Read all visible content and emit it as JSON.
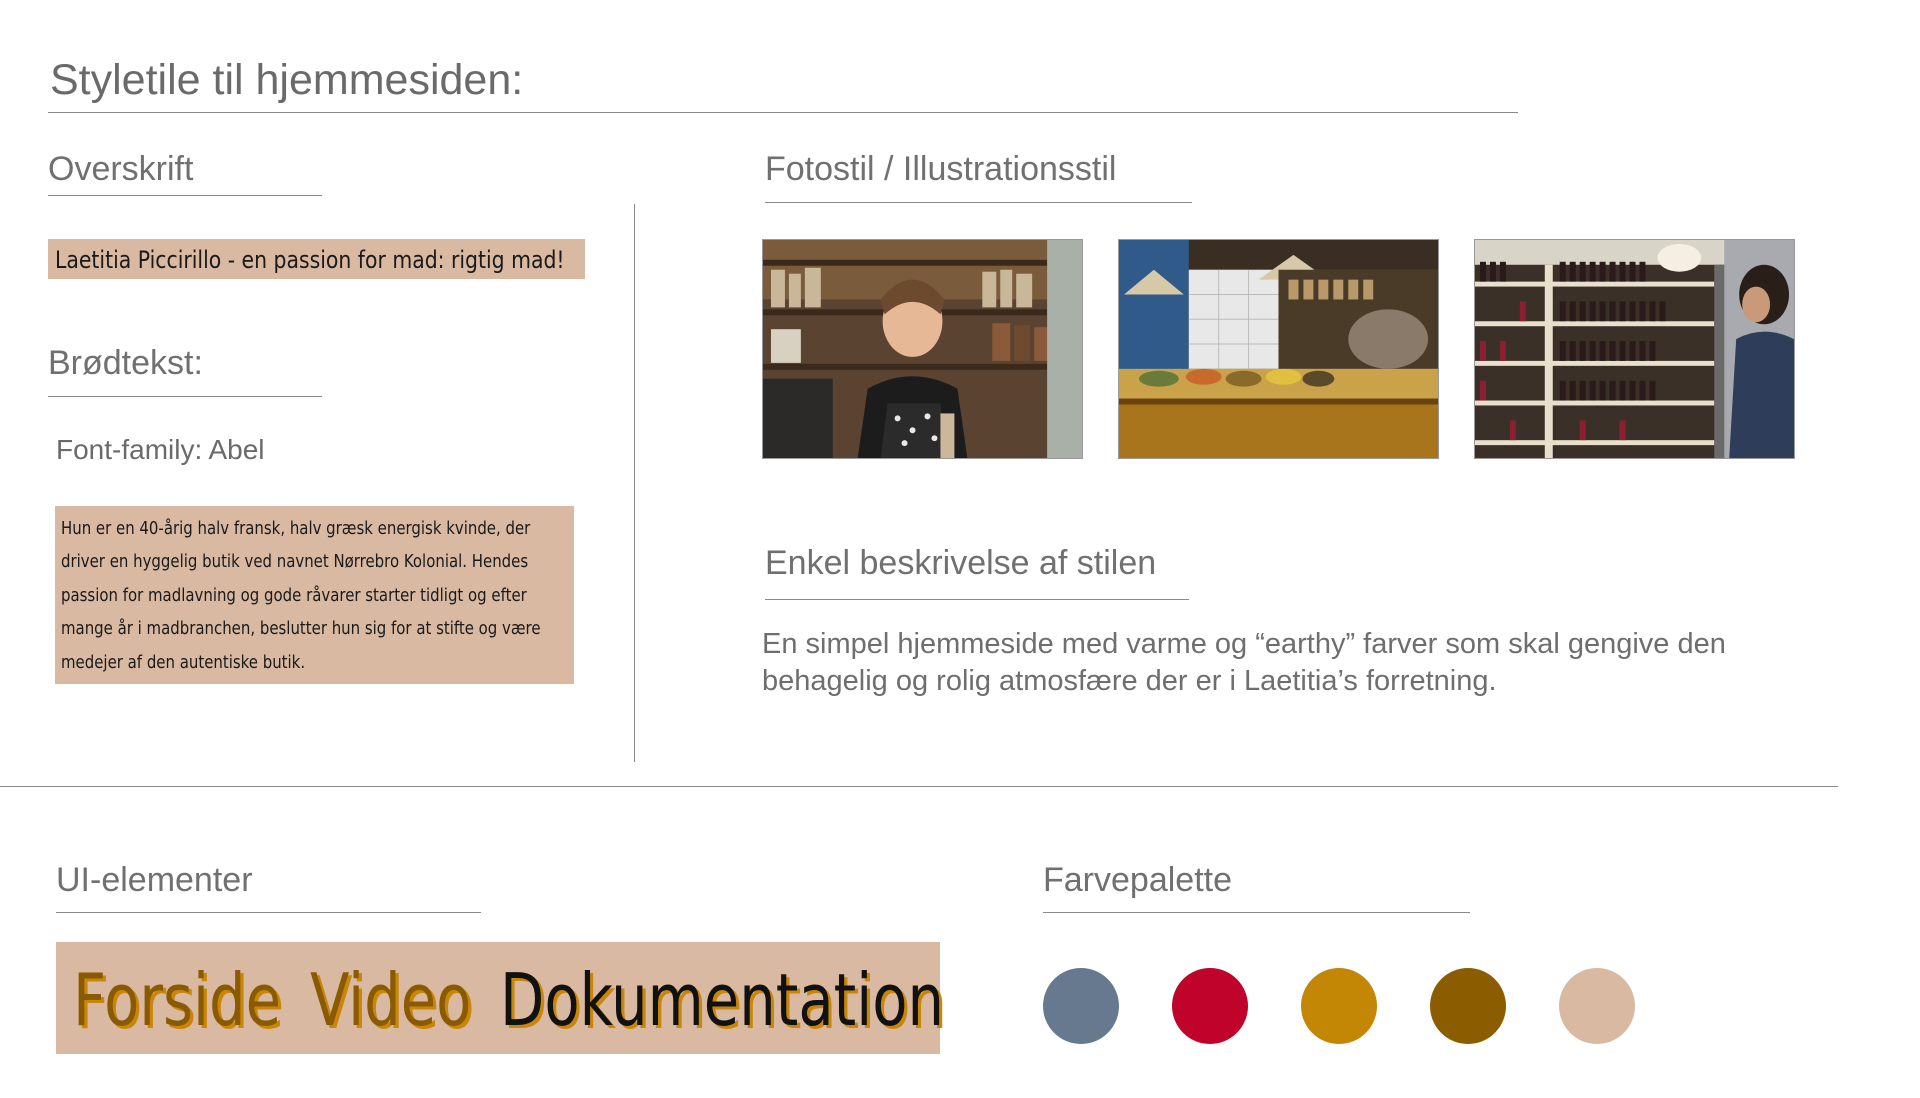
{
  "page": {
    "title": "Styletile til hjemmesiden:"
  },
  "headline_section": {
    "heading": "Overskrift",
    "sample": "Laetitia Piccirillo - en passion for mad: rigtig mad!"
  },
  "body_section": {
    "heading": "Brødtekst:",
    "font_label": "Font-family: Abel",
    "sample_lines": [
      "Hun er en 40-årig halv fransk, halv græsk energisk kvinde, der",
      "driver en hyggelig butik ved navnet Nørrebro Kolonial. Hendes",
      "passion for madlavning og gode råvarer starter tidligt og efter",
      "mange år i madbranchen, beslutter hun sig for at stifte og være",
      "medejer af den autentiske butik."
    ]
  },
  "photo_section": {
    "heading": "Fotostil / Illustrationsstil",
    "photos": [
      "shop-owner-photo",
      "deli-counter-photo",
      "wine-shelves-photo"
    ]
  },
  "description_section": {
    "heading": "Enkel beskrivelse af stilen",
    "lines": [
      "En simpel hjemmeside med varme og “earthy” farver som skal gengive den",
      "behagelig og rolig atmosfære der er i Laetitia’s forretning."
    ]
  },
  "ui_section": {
    "heading": "UI-elementer",
    "nav": [
      {
        "label": "Forside",
        "color": "#8a5a00"
      },
      {
        "label": "Video",
        "color": "#8a5a00"
      },
      {
        "label": "Dokumentation",
        "color": "#111111"
      }
    ],
    "nav_shadow_color": "#c8860a",
    "background": "#d9b9a1"
  },
  "palette_section": {
    "heading": "Farvepalette",
    "colors": [
      "#66798e",
      "#c0032a",
      "#c38605",
      "#8c5c00",
      "#d9b9a1"
    ]
  }
}
